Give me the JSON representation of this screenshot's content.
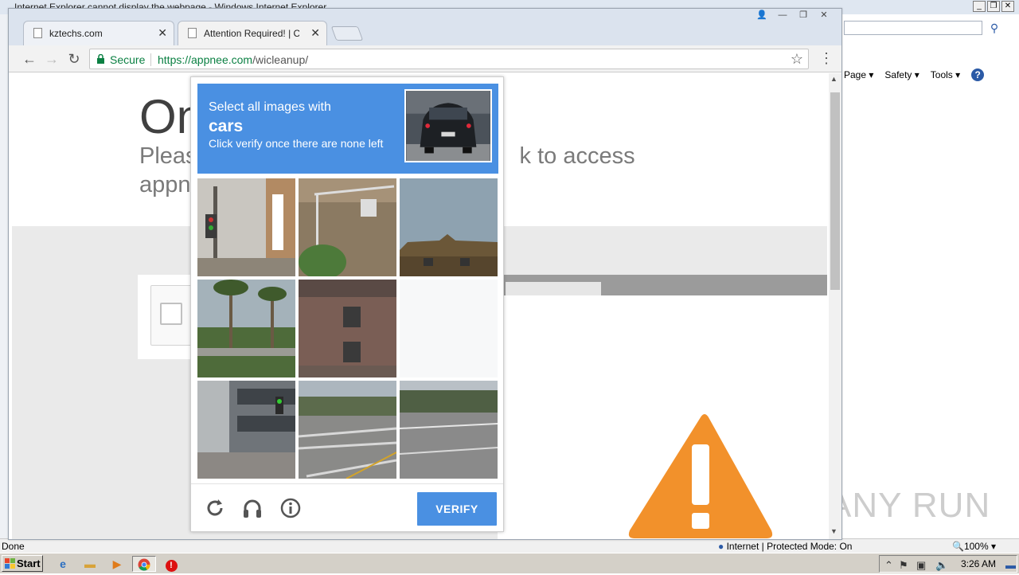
{
  "ie": {
    "title": "Internet Explorer cannot display the webpage - Windows Internet Explorer",
    "menus": [
      "Page",
      "Safety",
      "Tools"
    ],
    "status_left": "Done",
    "status_zone": "Internet | Protected Mode: On",
    "status_zoom": "100%"
  },
  "chrome": {
    "tabs": [
      {
        "label": "kztechs.com"
      },
      {
        "label": "Attention Required! | Cloudf"
      }
    ],
    "secure_label": "Secure",
    "url_scheme_host": "https://appnee.com",
    "url_path": "/wicleanup/"
  },
  "page": {
    "heading": "On",
    "subtitle_line1": "Pleas",
    "subtitle_line1_tail": "k to access",
    "subtitle_line2": "appn"
  },
  "captcha": {
    "line1": "Select all images with",
    "line2": "cars",
    "line3": "Click verify once there are none left",
    "verify_label": "VERIFY",
    "tiles": [
      {
        "name": "traffic-light-pole",
        "selected": false
      },
      {
        "name": "brick-wall-ac",
        "selected": false
      },
      {
        "name": "house-roof",
        "selected": false
      },
      {
        "name": "palm-trees-street",
        "selected": false
      },
      {
        "name": "brick-house",
        "selected": false
      },
      {
        "name": "empty-fading",
        "selected": true
      },
      {
        "name": "building-sidewalk",
        "selected": false
      },
      {
        "name": "road-crosswalk",
        "selected": false
      },
      {
        "name": "road-trees",
        "selected": false
      }
    ]
  },
  "watermark": "ANY RUN",
  "taskbar": {
    "start_label": "Start",
    "time": "3:26 AM"
  },
  "colors": {
    "captcha_blue": "#4a90e2",
    "secure_green": "#0b8043",
    "warning_orange": "#f2912b"
  }
}
